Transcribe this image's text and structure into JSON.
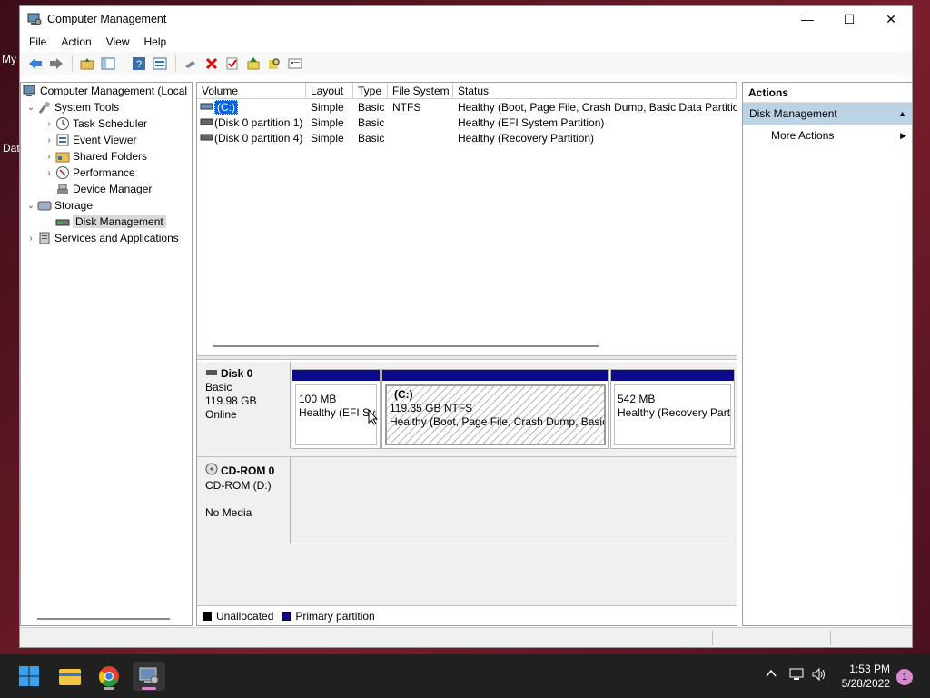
{
  "desktop": {
    "label_1": "My",
    "label_2": "Dat"
  },
  "window": {
    "title": "Computer Management",
    "controls": {
      "minimize": "—",
      "maximize": "☐",
      "close": "✕"
    }
  },
  "menu": [
    "File",
    "Action",
    "View",
    "Help"
  ],
  "tree": {
    "root": "Computer Management (Local",
    "system_tools": "System Tools",
    "task_scheduler": "Task Scheduler",
    "event_viewer": "Event Viewer",
    "shared_folders": "Shared Folders",
    "performance": "Performance",
    "device_manager": "Device Manager",
    "storage": "Storage",
    "disk_management": "Disk Management",
    "services": "Services and Applications"
  },
  "volumes": {
    "headers": [
      "Volume",
      "Layout",
      "Type",
      "File System",
      "Status"
    ],
    "rows": [
      {
        "volume": "(C:)",
        "layout": "Simple",
        "type": "Basic",
        "fs": "NTFS",
        "status": "Healthy (Boot, Page File, Crash Dump, Basic Data Partition)"
      },
      {
        "volume": "(Disk 0 partition 1)",
        "layout": "Simple",
        "type": "Basic",
        "fs": "",
        "status": "Healthy (EFI System Partition)"
      },
      {
        "volume": "(Disk 0 partition 4)",
        "layout": "Simple",
        "type": "Basic",
        "fs": "",
        "status": "Healthy (Recovery Partition)"
      }
    ]
  },
  "disk0": {
    "name": "Disk 0",
    "type": "Basic",
    "size": "119.98 GB",
    "state": "Online",
    "partitions": [
      {
        "title": "",
        "size": "100 MB",
        "status": "Healthy (EFI Sys"
      },
      {
        "title": "(C:)",
        "size": "119.35 GB NTFS",
        "status": "Healthy (Boot, Page File, Crash Dump, Basic I"
      },
      {
        "title": "",
        "size": "542 MB",
        "status": "Healthy (Recovery Part"
      }
    ]
  },
  "cdrom": {
    "name": "CD-ROM 0",
    "drive": "CD-ROM (D:)",
    "media": "No Media"
  },
  "legend": {
    "unallocated": "Unallocated",
    "primary": "Primary partition"
  },
  "actions": {
    "title": "Actions",
    "section": "Disk Management",
    "more": "More Actions"
  },
  "taskbar": {
    "time": "1:53 PM",
    "date": "5/28/2022",
    "notifications": "1"
  },
  "colors": {
    "primary_partition": "#0a0a8a",
    "selection": "#0a64d7",
    "actions_header": "#bcd3e6"
  }
}
